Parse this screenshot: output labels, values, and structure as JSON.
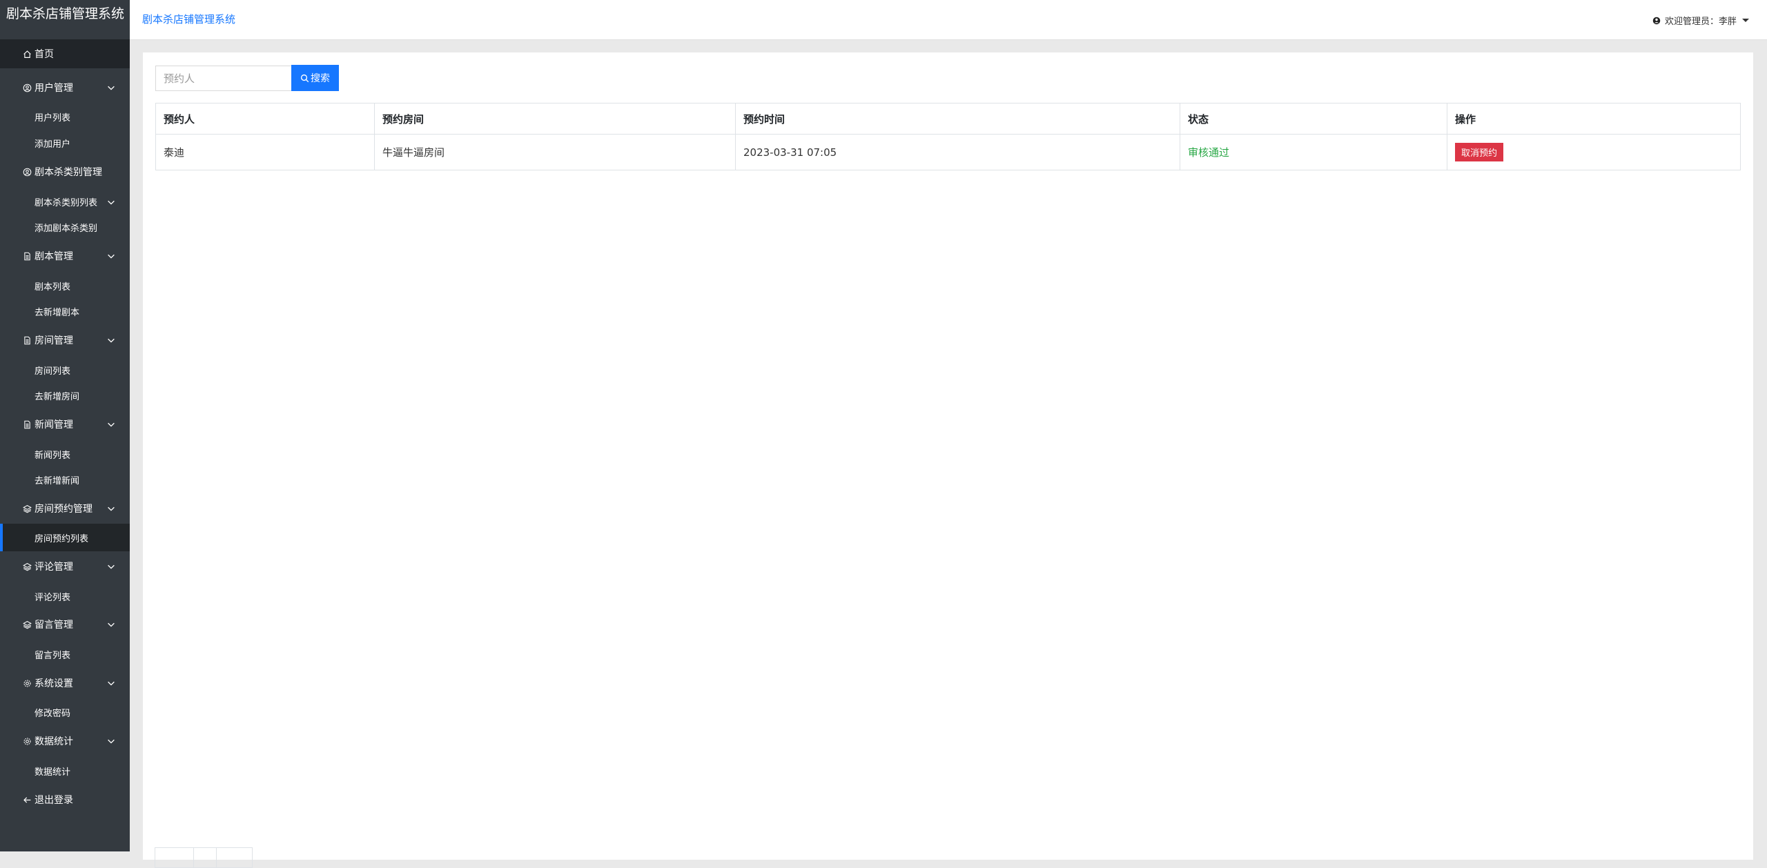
{
  "app": {
    "brand": "剧本杀店铺管理系统"
  },
  "topbar": {
    "breadcrumb": "剧本杀店铺管理系统",
    "user_label": "欢迎管理员：李胖"
  },
  "sidebar": {
    "home": "首页",
    "groups": [
      {
        "label": "用户管理",
        "icon": "user-circle-icon",
        "chevron": true,
        "items": [
          "用户列表",
          "添加用户"
        ]
      },
      {
        "label": "剧本杀类别管理",
        "icon": "user-circle-icon",
        "chevron": false,
        "items": [
          "剧本杀类别列表",
          "添加剧本杀类别"
        ]
      },
      {
        "label": "剧本管理",
        "icon": "document-icon",
        "chevron": true,
        "items": [
          "剧本列表",
          "去新增剧本"
        ]
      },
      {
        "label": "房间管理",
        "icon": "document-icon",
        "chevron": true,
        "items": [
          "房间列表",
          "去新增房间"
        ]
      },
      {
        "label": "新闻管理",
        "icon": "document-icon",
        "chevron": true,
        "items": [
          "新闻列表",
          "去新增新闻"
        ]
      },
      {
        "label": "房间预约管理",
        "icon": "layers-icon",
        "chevron": true,
        "items": [
          "房间预约列表"
        ]
      },
      {
        "label": "评论管理",
        "icon": "layers-icon",
        "chevron": true,
        "items": [
          "评论列表"
        ]
      },
      {
        "label": "留言管理",
        "icon": "layers-icon",
        "chevron": true,
        "items": [
          "留言列表"
        ]
      },
      {
        "label": "系统设置",
        "icon": "gear-icon",
        "chevron": true,
        "items": [
          "修改密码"
        ]
      },
      {
        "label": "数据统计",
        "icon": "gear-icon",
        "chevron": true,
        "items": [
          "数据统计"
        ]
      }
    ],
    "active_item": "房间预约列表",
    "logout": "退出登录"
  },
  "search": {
    "placeholder": "预约人",
    "button_label": "搜索"
  },
  "table": {
    "headers": [
      "预约人",
      "预约房间",
      "预约时间",
      "状态",
      "操作"
    ],
    "rows": [
      {
        "person": "泰迪",
        "room": "牛逼牛逼房间",
        "time": "2023-03-31 07:05",
        "status": "审核通过",
        "action": "取消预约"
      }
    ]
  },
  "colors": {
    "sidebar": "#343a40",
    "accent": "#1677ff",
    "status_ok": "#28a745",
    "danger": "#dc3545"
  }
}
